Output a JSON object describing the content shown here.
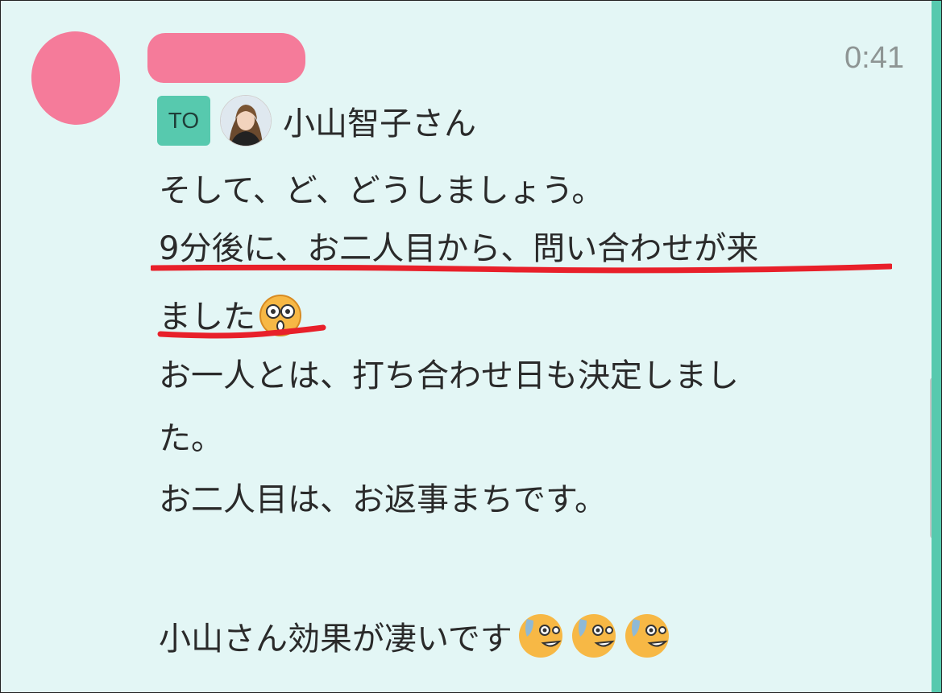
{
  "message": {
    "timestamp": "0:41",
    "to_badge": "TO",
    "to_recipient": "小山智子さん",
    "lines": [
      "そして、ど、どうしましょう。",
      "9分後に、お二人目から、問い合わせが来",
      "ました",
      "お一人とは、打ち合わせ日も決定しまし",
      "た。",
      "お二人目は、お返事まちです。",
      "",
      "小山さん効果が凄いです"
    ]
  },
  "colors": {
    "background": "#e3f6f5",
    "redaction": "#f57b9a",
    "to_badge": "#57c9ae",
    "underline": "#e8202a",
    "timestamp": "#8e9594"
  },
  "icons": {
    "line3_emoji": "astonished-face-emoji",
    "last_line_emojis": [
      "grinning-sweat-face-emoji",
      "grinning-sweat-face-emoji",
      "grinning-sweat-face-emoji"
    ]
  }
}
